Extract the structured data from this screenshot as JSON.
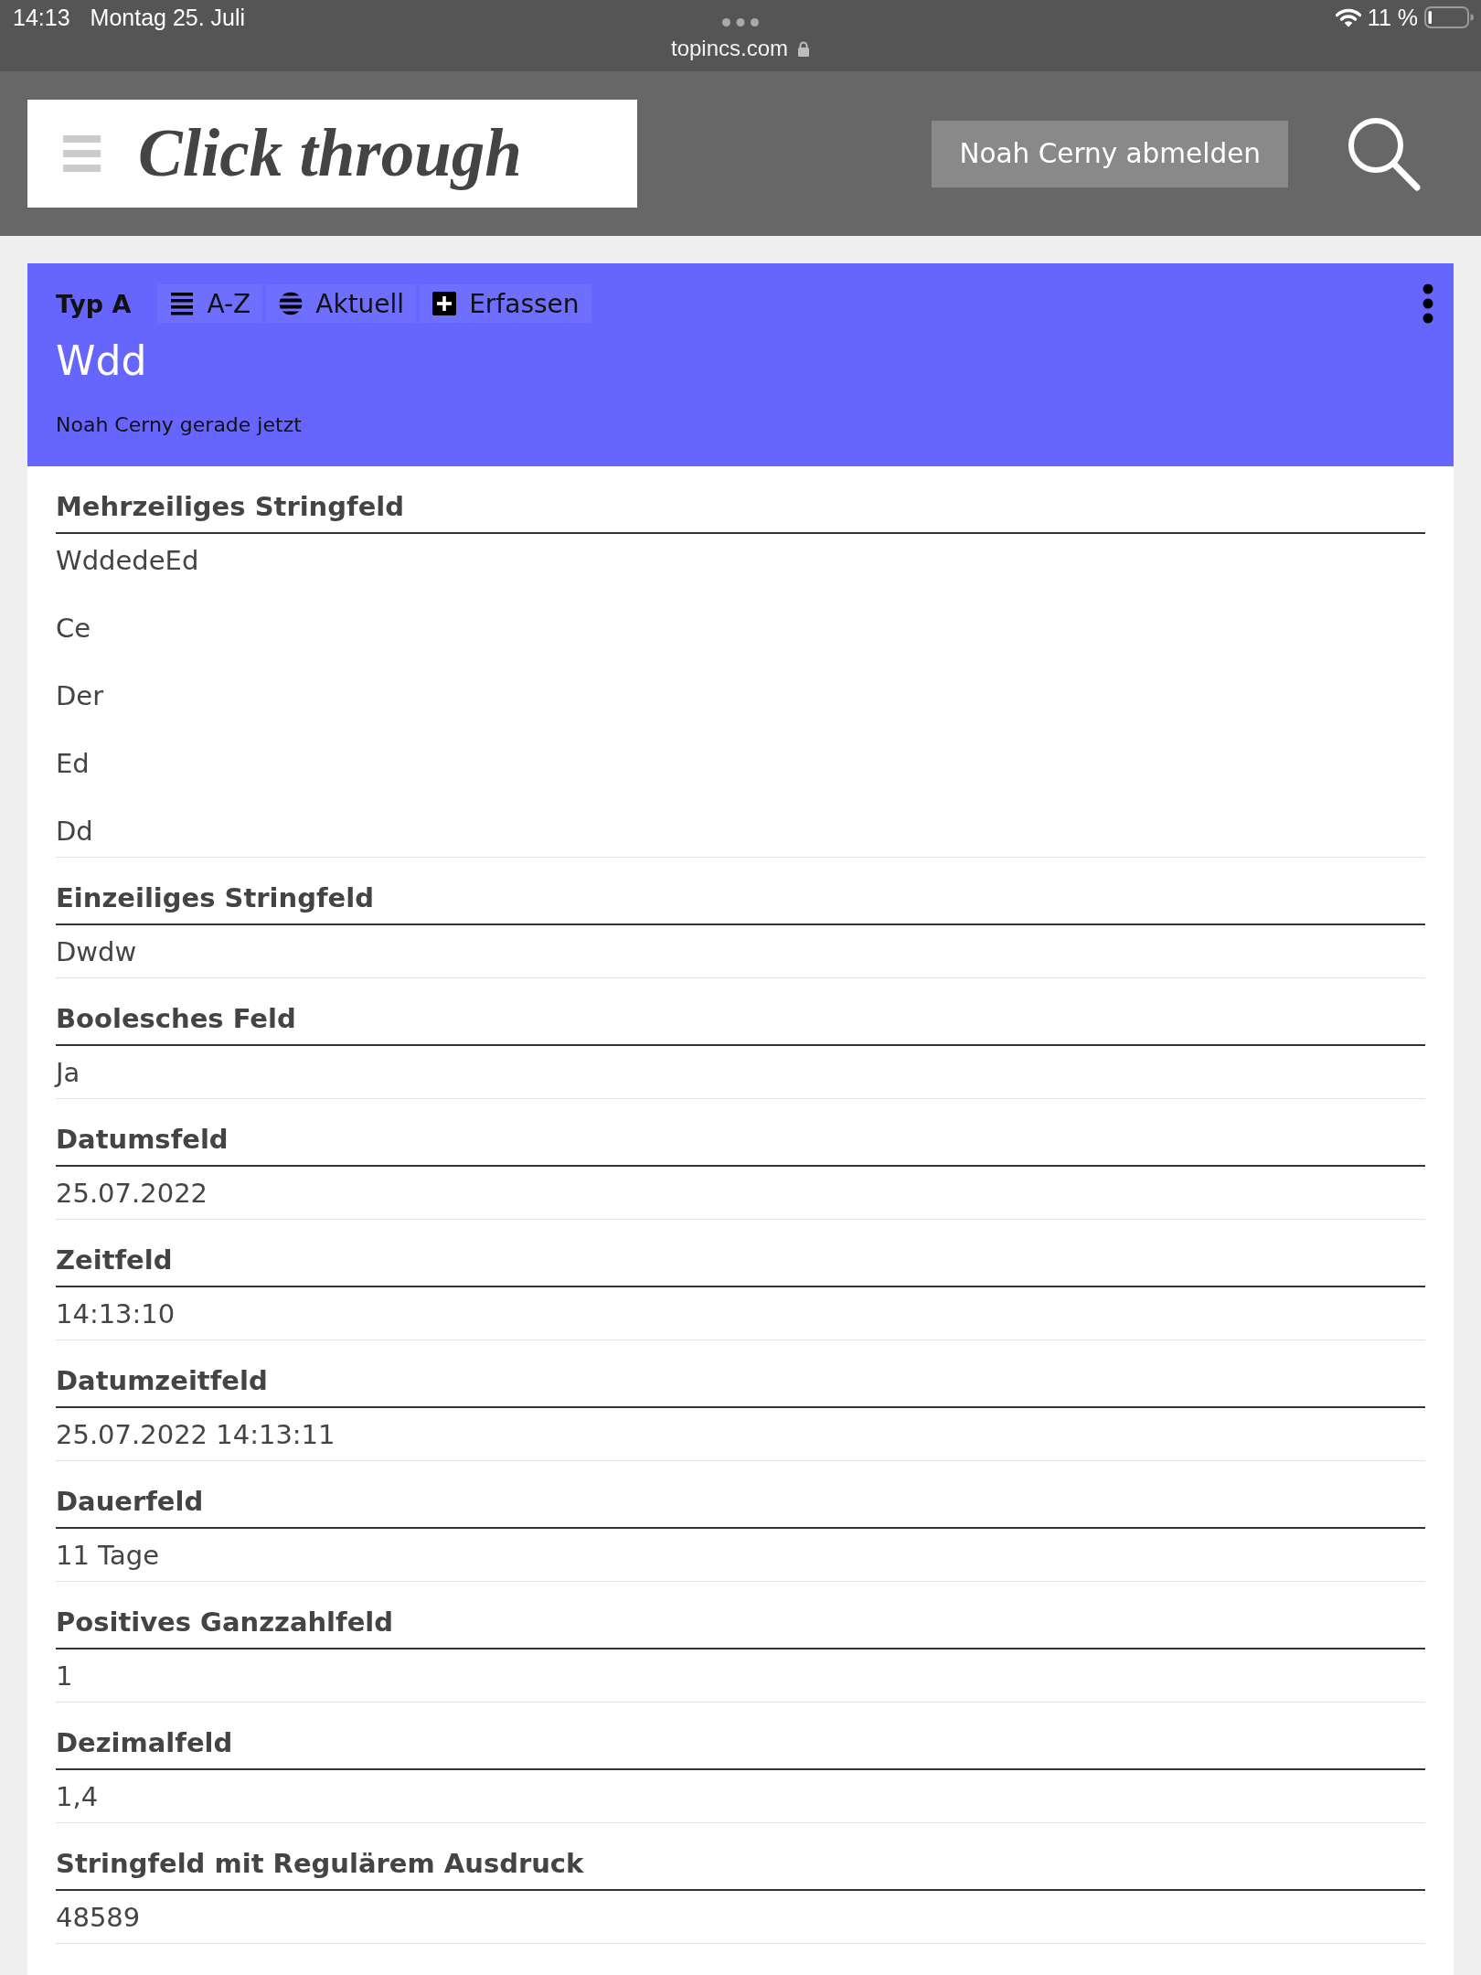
{
  "status_bar": {
    "time": "14:13",
    "date": "Montag 25. Juli",
    "url": "topincs.com",
    "battery": "11 %"
  },
  "header": {
    "logo": "Click through",
    "logout_button": "Noah Cerny abmelden"
  },
  "topic": {
    "type": "Typ A",
    "actions": [
      {
        "kind": "list",
        "label": "A-Z"
      },
      {
        "kind": "recent",
        "label": "Aktuell"
      },
      {
        "kind": "create",
        "label": "Erfassen"
      }
    ],
    "title": "Wdd",
    "meta": "Noah Cerny gerade jetzt"
  },
  "fields": [
    {
      "label": "Mehrzeiliges Stringfeld",
      "values": [
        "WddedeEd",
        "Ce",
        "Der",
        "Ed",
        "Dd"
      ]
    },
    {
      "label": "Einzeiliges Stringfeld",
      "values": [
        "Dwdw"
      ]
    },
    {
      "label": "Boolesches Feld",
      "values": [
        "Ja"
      ]
    },
    {
      "label": "Datumsfeld",
      "values": [
        "25.07.2022"
      ]
    },
    {
      "label": "Zeitfeld",
      "values": [
        "14:13:10"
      ]
    },
    {
      "label": "Datumzeitfeld",
      "values": [
        "25.07.2022 14:13:11"
      ]
    },
    {
      "label": "Dauerfeld",
      "values": [
        "11 Tage"
      ]
    },
    {
      "label": "Positives Ganzzahlfeld",
      "values": [
        "1"
      ]
    },
    {
      "label": "Dezimalfeld",
      "values": [
        "1,4"
      ]
    },
    {
      "label": "Stringfeld mit Regulärem Ausdruck",
      "values": [
        "48589"
      ]
    }
  ]
}
